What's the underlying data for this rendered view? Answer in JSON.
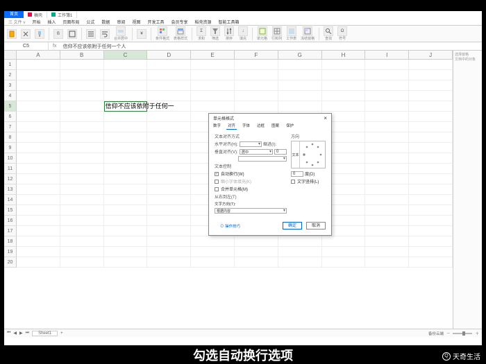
{
  "title_tabs": {
    "app": "首页",
    "doc1": "稿壳",
    "doc2": "工作簿1"
  },
  "menu": [
    "三 文件 v",
    "开始",
    "插入",
    "页面布局",
    "公式",
    "数据",
    "审阅",
    "视图",
    "开发工具",
    "会员专享",
    "稻壳资源",
    "智能工具箱"
  ],
  "ribbon_labels": [
    "格式刷",
    "粘贴",
    "自动换行",
    "合并居中",
    "条件格式",
    "表格样式",
    "求和",
    "筛选",
    "排序",
    "填充",
    "单元格",
    "行和列",
    "工作表",
    "冻结窗格",
    "查找",
    "符号"
  ],
  "formula_bar": {
    "cell_ref": "C5",
    "fx": "fx",
    "content": "信仰不应该依附于任何一个人"
  },
  "columns": [
    "A",
    "B",
    "C",
    "D",
    "E",
    "F",
    "G",
    "H",
    "I",
    "J"
  ],
  "rows_count": 20,
  "active_row": 5,
  "active_col_index": 2,
  "cell_text": "信仰不应该依附于任何一",
  "sidepanel": {
    "a": "选择窗格",
    "b": "文档中的对象"
  },
  "sheet_tab": "Sheet1",
  "sheet_info": "备份云端",
  "dialog": {
    "title": "单元格格式",
    "tabs": [
      "数字",
      "对齐",
      "字体",
      "边框",
      "图案",
      "保护"
    ],
    "active_tab_i": 1,
    "section_align": "文本对齐方式",
    "h_label": "水平对齐(H):",
    "h_value": "",
    "indent_label": "缩进(I):",
    "indent_value": "0",
    "v_label": "垂直对齐(V):",
    "v_value": "居中",
    "section_ctrl": "文本控制",
    "chk_wrap": "自动换行(W)",
    "chk_shrink": "缩小字体填充(K)",
    "chk_merge": "合并单元格(M)",
    "wrap_checked": "✓",
    "section_rtl": "从右到左(T)",
    "rtl_label": "文字方向(T):",
    "rtl_value": "根据内容",
    "orient_h": "方向",
    "orient_text": "文本",
    "deg_val": "0",
    "deg_label": "度(D)",
    "chk_stack": "文字竖排(L)",
    "opcell": "⊙ 操作技巧",
    "ok": "确定",
    "cancel": "取消"
  },
  "subtitle": "勾选自动换行选项",
  "watermark": "天奇生活"
}
